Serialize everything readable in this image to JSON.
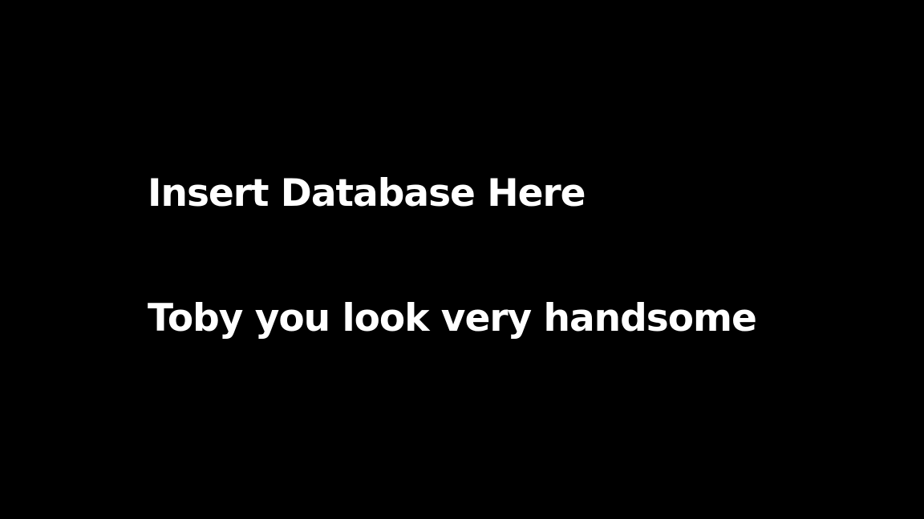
{
  "slide": {
    "background_color": "#000000",
    "text_color": "#ffffff",
    "lines": [
      "Insert Database Here",
      "Toby you look very handsome"
    ]
  }
}
